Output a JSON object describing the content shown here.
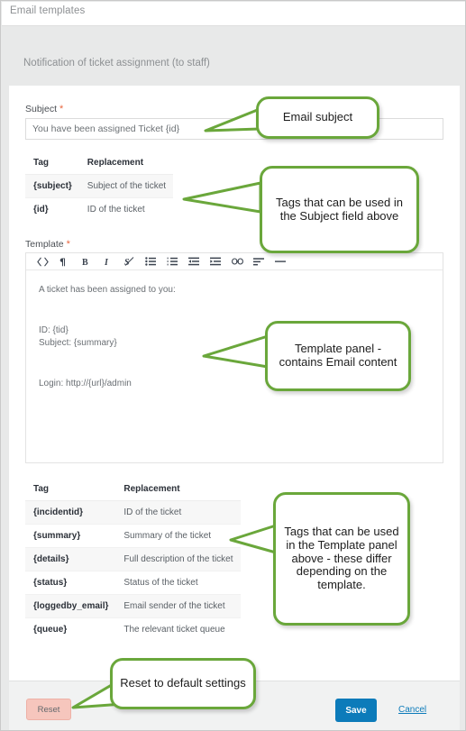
{
  "window": {
    "title": "Email templates",
    "section_title": "Notification of ticket assignment (to staff)"
  },
  "form": {
    "subject_label": "Subject",
    "subject_required_mark": "*",
    "subject_value": "You have been assigned Ticket {id}",
    "template_label": "Template",
    "template_required_mark": "*"
  },
  "subject_tags_table": {
    "headers": [
      "Tag",
      "Replacement"
    ],
    "rows": [
      {
        "tag": "{subject}",
        "replacement": "Subject of the ticket"
      },
      {
        "tag": "{id}",
        "replacement": "ID of the ticket"
      }
    ]
  },
  "editor": {
    "toolbar_buttons": [
      "source-code-icon",
      "pilcrow-icon",
      "bold-icon",
      "italic-icon",
      "remove-format-icon",
      "unordered-list-icon",
      "ordered-list-icon",
      "outdent-icon",
      "indent-icon",
      "link-icon",
      "align-left-icon",
      "horizontal-rule-icon"
    ],
    "content_lines": [
      "A ticket has been assigned to you:",
      "ID: {tid}",
      "Subject: {summary}",
      "Login: http://{url}/admin"
    ]
  },
  "template_tags_table": {
    "headers": [
      "Tag",
      "Replacement"
    ],
    "rows": [
      {
        "tag": "{incidentid}",
        "replacement": "ID of the ticket"
      },
      {
        "tag": "{summary}",
        "replacement": "Summary of the ticket"
      },
      {
        "tag": "{details}",
        "replacement": "Full description of the ticket"
      },
      {
        "tag": "{status}",
        "replacement": "Status of the ticket"
      },
      {
        "tag": "{loggedby_email}",
        "replacement": "Email sender of the ticket"
      },
      {
        "tag": "{queue}",
        "replacement": "The relevant ticket queue"
      }
    ]
  },
  "footer": {
    "reset_label": "Reset",
    "save_label": "Save",
    "cancel_label": "Cancel"
  },
  "callouts": {
    "subject": "Email subject",
    "subject_tags": "Tags that can be used in the Subject field above",
    "template": "Template panel - contains Email content",
    "template_tags": "Tags that can be used in the Template panel above - these differ depending on the template.",
    "reset": "Reset to default settings"
  },
  "colors": {
    "callout_border": "#6aa73b",
    "save_button": "#0c7bba",
    "reset_button": "#f6c6bd",
    "required_mark": "#e8663f",
    "backdrop": "#e8e9e9"
  }
}
